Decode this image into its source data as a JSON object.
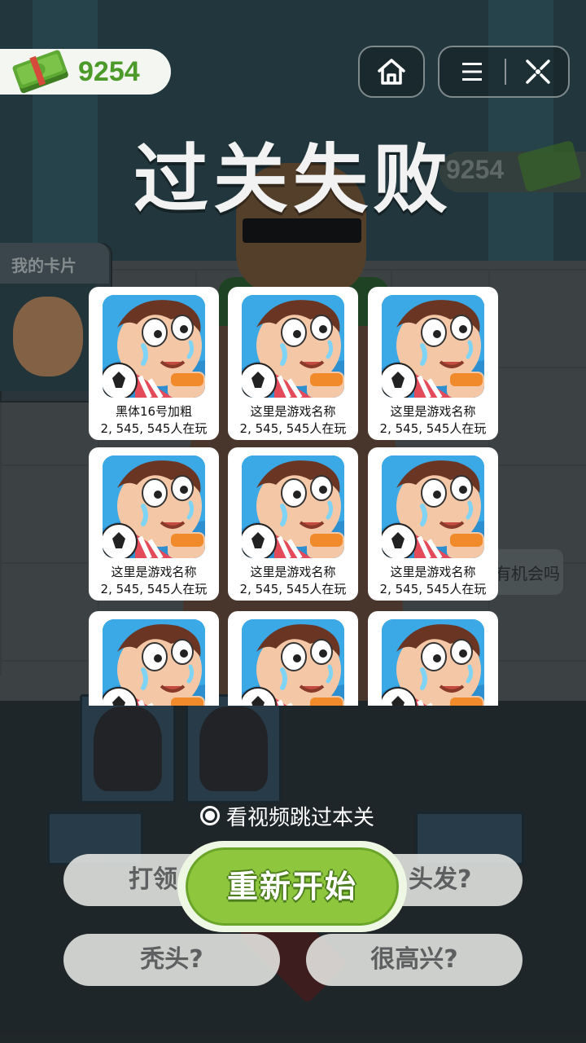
{
  "currency": {
    "amount": "9254",
    "icon": "cash-stack-icon"
  },
  "toolbar": {
    "home_icon": "home-icon",
    "menu_icon": "menu-icon",
    "close_icon": "close-target-icon"
  },
  "title": "过关失败",
  "background": {
    "my_cards_label": "我的卡片",
    "money_ghost": "9254",
    "chat_hint": "有机会吗"
  },
  "games": [
    {
      "name": "黑体16号加粗",
      "players": "2, 545, 545人在玩"
    },
    {
      "name": "这里是游戏名称",
      "players": "2, 545, 545人在玩"
    },
    {
      "name": "这里是游戏名称",
      "players": "2, 545, 545人在玩"
    },
    {
      "name": "这里是游戏名称",
      "players": "2, 545, 545人在玩"
    },
    {
      "name": "这里是游戏名称",
      "players": "2, 545, 545人在玩"
    },
    {
      "name": "这里是游戏名称",
      "players": "2, 545, 545人在玩"
    },
    {
      "name": "",
      "players": ""
    },
    {
      "name": "",
      "players": ""
    },
    {
      "name": "",
      "players": ""
    }
  ],
  "skip": {
    "label": "看视频跳过本关"
  },
  "restart": {
    "label": "重新开始"
  },
  "options": {
    "opt1": "打领",
    "opt2": "头发?",
    "opt3": "秃头?",
    "opt4": "很高兴?"
  },
  "colors": {
    "accent_green": "#8ec63d",
    "money_green": "#4c9a2a"
  }
}
